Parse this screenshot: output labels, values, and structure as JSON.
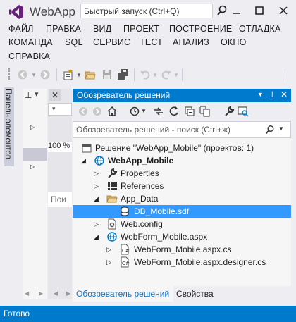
{
  "title_bar": {
    "app_title": "WebApp",
    "quick_launch_placeholder": "Быстрый запуск (Ctrl+Q)"
  },
  "menu": {
    "row1": [
      "ФАЙЛ",
      "ПРАВКА",
      "ВИД",
      "ПРОЕКТ",
      "ПОСТРОЕНИЕ",
      "ОТЛАДКА"
    ],
    "row2": [
      "КОМАНДА",
      "SQL",
      "СЕРВИС",
      "ТЕСТ",
      "АНАЛИЗ",
      "ОКНО"
    ],
    "row3": [
      "СПРАВКА"
    ]
  },
  "toolbox": {
    "label": "Панель элементов"
  },
  "middle_pane": {
    "zoom": "100 %",
    "search_stub": "Пои"
  },
  "solution_explorer": {
    "title": "Обозреватель решений",
    "search_placeholder": "Обозреватель решений - поиск (Ctrl+ж)",
    "tree": [
      {
        "label": "Решение \"WebApp_Mobile\"  (проектов: 1)",
        "level": 0,
        "arrow": "",
        "icon": "solution-icon",
        "bold": false
      },
      {
        "label": "WebApp_Mobile",
        "level": 0,
        "arrow": "expanded",
        "icon": "web-project-icon",
        "bold": true
      },
      {
        "label": "Properties",
        "level": 1,
        "arrow": "collapsed",
        "icon": "wrench-icon",
        "bold": false
      },
      {
        "label": "References",
        "level": 1,
        "arrow": "collapsed",
        "icon": "references-icon",
        "bold": false
      },
      {
        "label": "App_Data",
        "level": 1,
        "arrow": "expanded",
        "icon": "folder-open-icon",
        "bold": false
      },
      {
        "label": "DB_Mobile.sdf",
        "level": 2,
        "arrow": "",
        "icon": "database-icon",
        "bold": false,
        "selected": true
      },
      {
        "label": "Web.config",
        "level": 1,
        "arrow": "collapsed",
        "icon": "config-icon",
        "bold": false
      },
      {
        "label": "WebForm_Mobile.aspx",
        "level": 1,
        "arrow": "expanded",
        "icon": "globe-icon",
        "bold": false
      },
      {
        "label": "WebForm_Mobile.aspx.cs",
        "level": 2,
        "arrow": "collapsed",
        "icon": "cs-file-icon",
        "bold": false
      },
      {
        "label": "WebForm_Mobile.aspx.designer.cs",
        "level": 2,
        "arrow": "collapsed",
        "icon": "cs-file-icon",
        "bold": false
      }
    ],
    "tabs": [
      "Обозреватель решений",
      "Свойства"
    ]
  },
  "status_bar": {
    "text": "Готово"
  },
  "colors": {
    "accent": "#007acc",
    "selection": "#3399ff",
    "vs_purple": "#68217a"
  }
}
